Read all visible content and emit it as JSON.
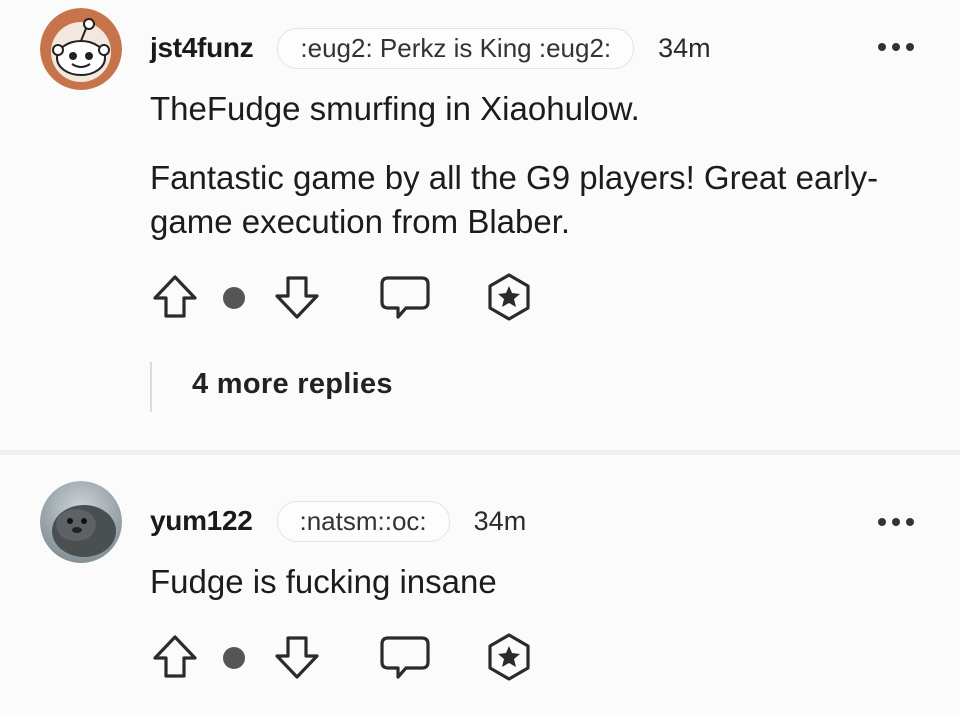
{
  "comments": [
    {
      "username": "jst4funz",
      "flair": ":eug2: Perkz is King :eug2:",
      "time": "34m",
      "paragraphs": [
        "TheFudge smurfing in Xiaohulow.",
        "Fantastic game by all the G9 players! Great early-game execution from Blaber."
      ],
      "more_replies": "4 more replies",
      "avatar": "snoo-avatar"
    },
    {
      "username": "yum122",
      "flair": ":natsm::oc:",
      "time": "34m",
      "paragraphs": [
        "Fudge is fucking insane"
      ],
      "avatar": "seal-photo-avatar"
    }
  ],
  "icons": {
    "upvote": "arrow-up-icon",
    "vote_dot": "vote-separator-dot",
    "downvote": "arrow-down-icon",
    "reply": "chat-bubble-icon",
    "award": "award-star-icon",
    "more": "ellipsis-icon"
  },
  "colors": {
    "background": "#fbfbfb",
    "text": "#1a1a1b",
    "icon": "#2b2b2b",
    "avatar_ring": "#c8744a"
  }
}
